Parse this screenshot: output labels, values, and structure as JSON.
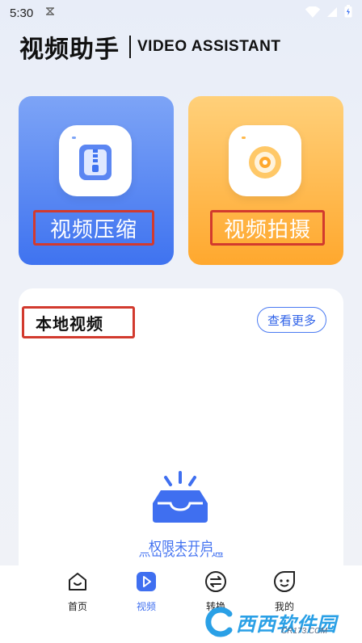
{
  "status_bar": {
    "time": "5:30",
    "notification_icon": "sync-icon",
    "icons": [
      "wifi-icon",
      "signal-icon",
      "battery-icon"
    ]
  },
  "header": {
    "title": "视频助手",
    "subtitle": "VIDEO ASSISTANT"
  },
  "cards": [
    {
      "label": "视频压缩",
      "icon": "zip-file-icon",
      "accent": "#3f73f0"
    },
    {
      "label": "视频拍摄",
      "icon": "camera-lens-icon",
      "accent": "#ffa82e"
    }
  ],
  "local_videos": {
    "title": "本地视频",
    "more_label": "查看更多",
    "empty_icon": "empty-inbox-icon",
    "empty_text": "权限未开启",
    "empty_subtext": "点击我去去开通"
  },
  "tabs": [
    {
      "label": "首页",
      "icon": "home-face-icon",
      "active": false
    },
    {
      "label": "视频",
      "icon": "play-icon",
      "active": true
    },
    {
      "label": "转换",
      "icon": "swap-icon",
      "active": false
    },
    {
      "label": "我的",
      "icon": "profile-face-icon",
      "active": false
    }
  ],
  "watermark": {
    "text": "西西软件园",
    "domain": "CR173.COM"
  },
  "colors": {
    "primary": "#3f6ff0",
    "highlight_border": "#d23a2e",
    "shoot_card": "#ffa82e"
  }
}
